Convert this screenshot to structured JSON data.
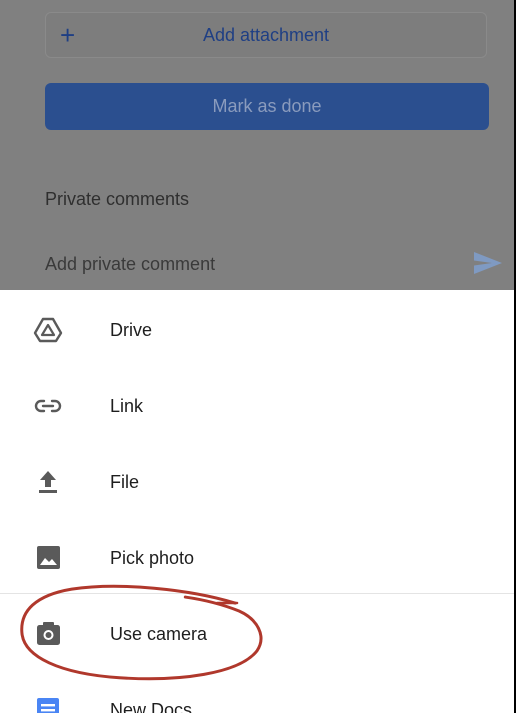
{
  "assignment": {
    "add_attachment_label": "Add attachment",
    "mark_done_label": "Mark as done",
    "private_comments_title": "Private comments",
    "comment_placeholder": "Add private comment"
  },
  "attach_menu": {
    "items": [
      {
        "label": "Drive",
        "icon": "drive-icon"
      },
      {
        "label": "Link",
        "icon": "link-icon"
      },
      {
        "label": "File",
        "icon": "upload-icon"
      },
      {
        "label": "Pick photo",
        "icon": "photo-icon"
      },
      {
        "label": "Use camera",
        "icon": "camera-icon"
      },
      {
        "label": "New Docs",
        "icon": "docs-icon"
      }
    ]
  },
  "colors": {
    "accent_blue": "#2b4f8f",
    "docs_blue": "#4a85f4",
    "annotation_red": "#b0382c"
  }
}
